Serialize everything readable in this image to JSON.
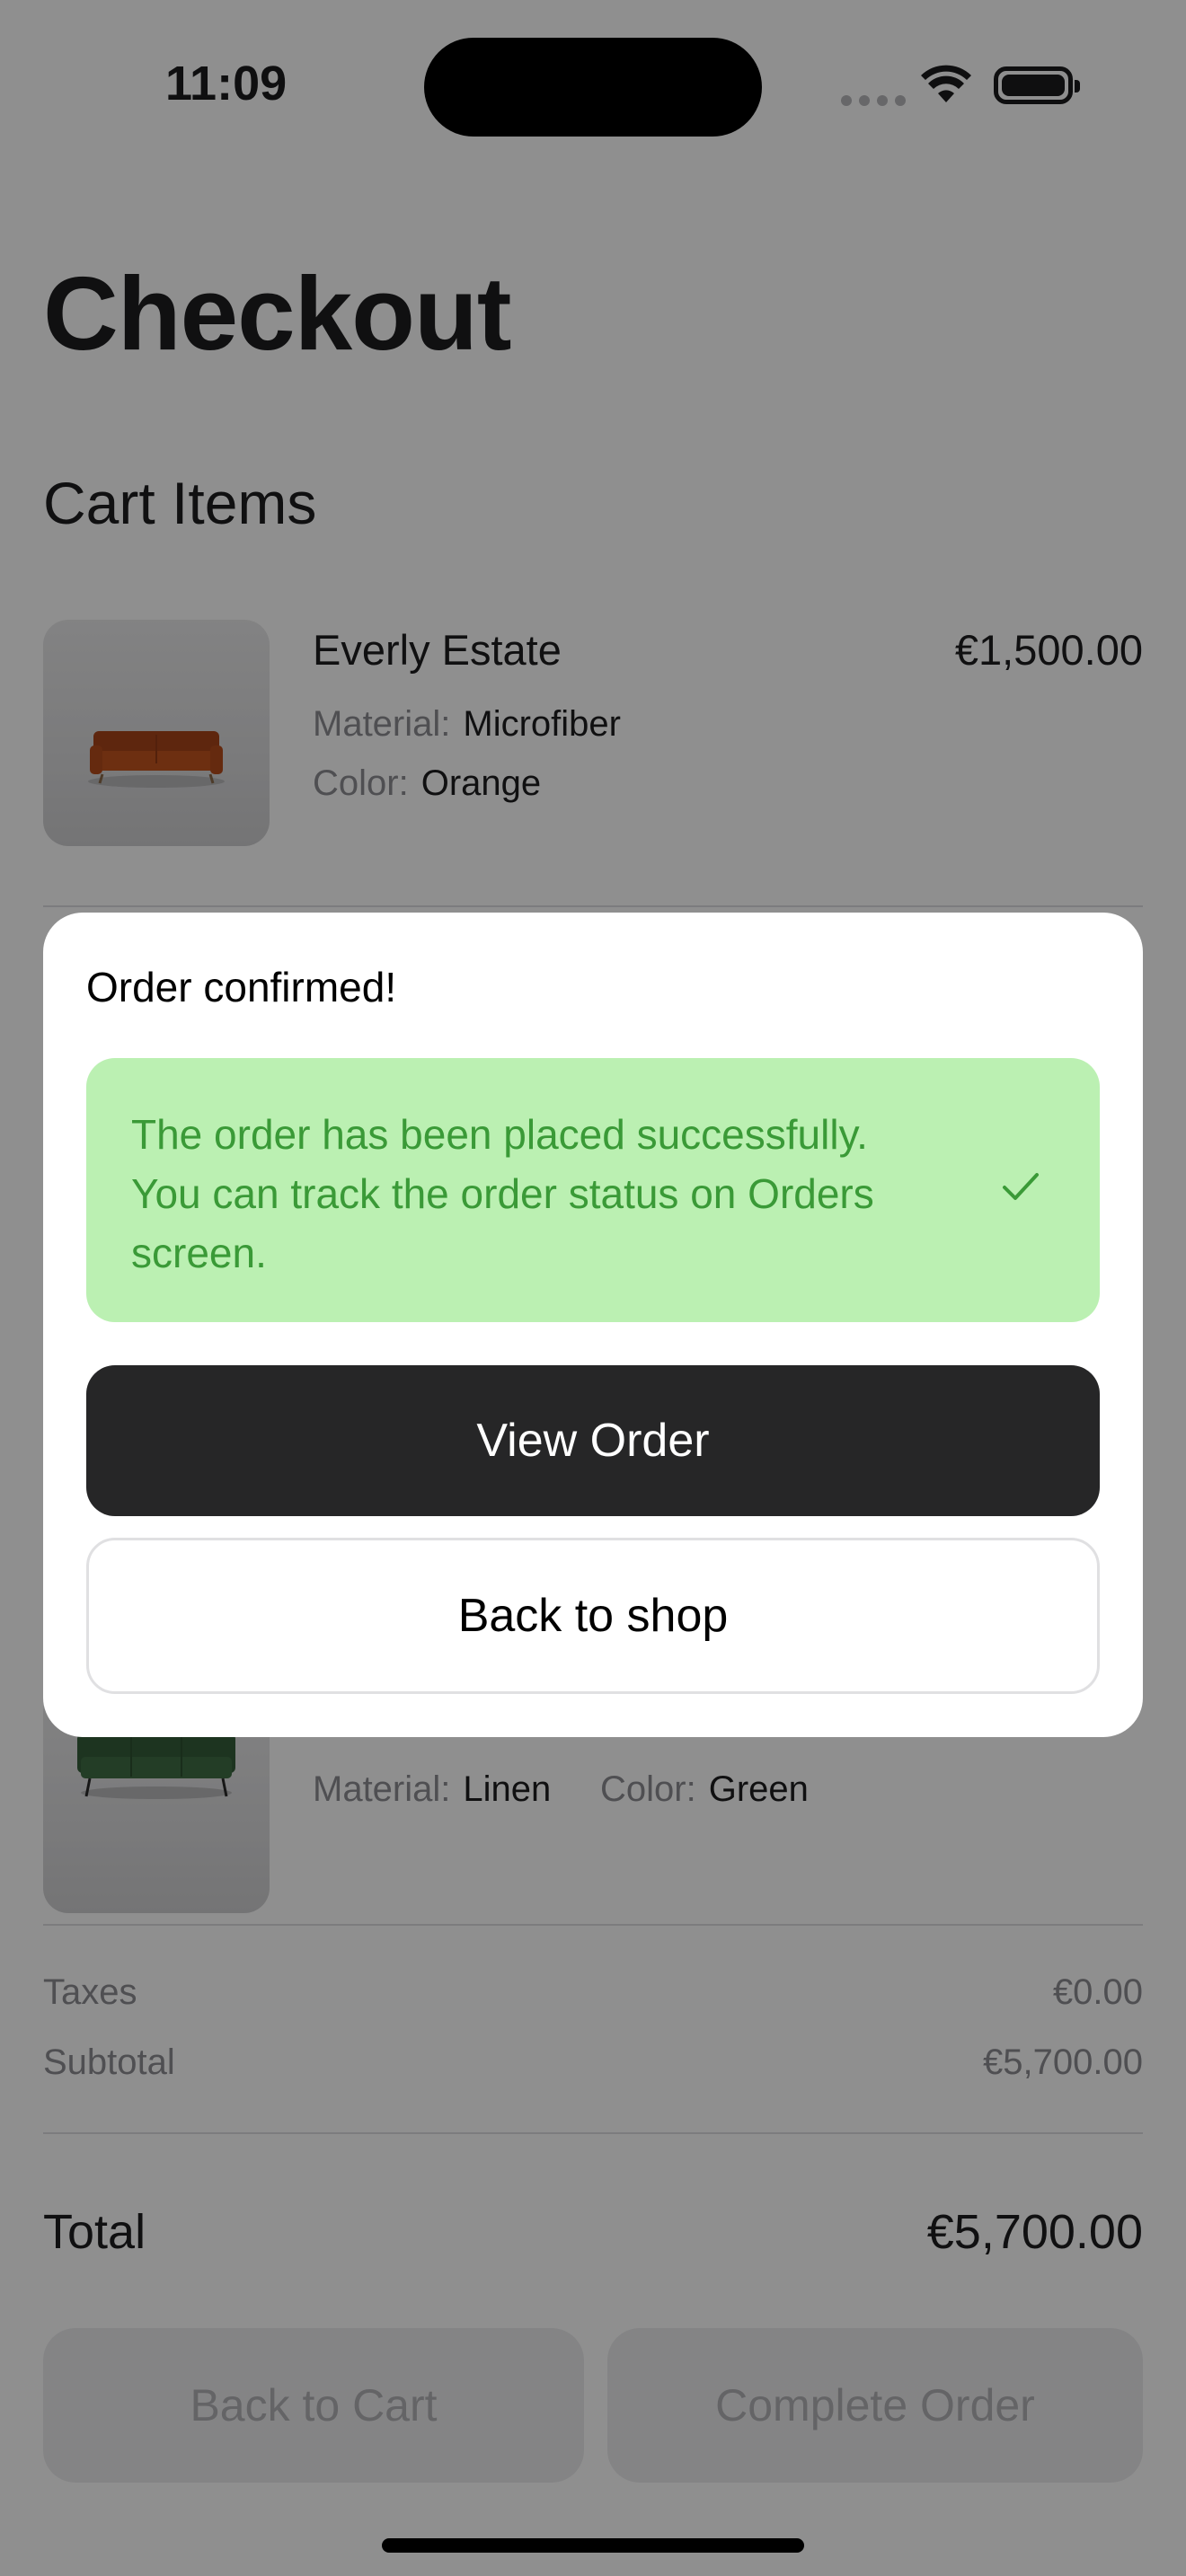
{
  "status_bar": {
    "time": "11:09"
  },
  "page": {
    "title": "Checkout",
    "section_title": "Cart Items"
  },
  "cart_items": [
    {
      "name": "Everly Estate",
      "price": "€1,500.00",
      "material_label": "Material:",
      "material": "Microfiber",
      "color_label": "Color:",
      "color": "Orange",
      "sofa_color": "#c2541f"
    },
    {
      "name": "",
      "price": "",
      "material_label": "Material:",
      "material": "Linen",
      "color_label": "Color:",
      "color": "Green",
      "sofa_color": "#3f6e45"
    }
  ],
  "summary": {
    "taxes_label": "Taxes",
    "taxes_value": "€0.00",
    "subtotal_label": "Subtotal",
    "subtotal_value": "€5,700.00",
    "total_label": "Total",
    "total_value": "€5,700.00"
  },
  "actions": {
    "back_to_cart": "Back to Cart",
    "complete_order": "Complete Order"
  },
  "dialog": {
    "title": "Order confirmed!",
    "message": "The order has been placed successfully. You can track the order status on Orders screen.",
    "view_order": "View Order",
    "back_to_shop": "Back to shop",
    "success_color": "#3a9a37"
  }
}
